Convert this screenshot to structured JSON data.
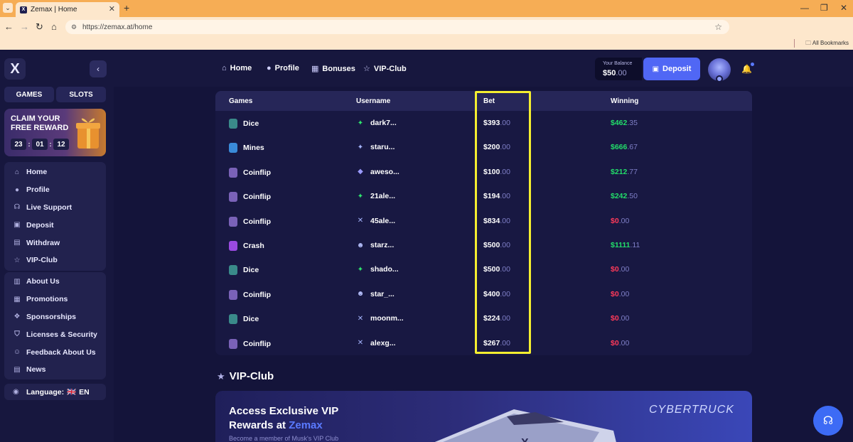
{
  "browser": {
    "tab_title": "Zemax | Home",
    "url": "https://zemax.at/home",
    "bookmarks_label": "All Bookmarks"
  },
  "sidebar": {
    "logo": "X",
    "categories": [
      "GAMES",
      "SLOTS"
    ],
    "promo": {
      "title": "CLAIM YOUR FREE REWARD",
      "timer": [
        "23",
        "01",
        "12"
      ]
    },
    "nav_primary": [
      {
        "label": "Home",
        "icon": "home-icon"
      },
      {
        "label": "Profile",
        "icon": "user-icon"
      },
      {
        "label": "Live Support",
        "icon": "headset-icon"
      },
      {
        "label": "Deposit",
        "icon": "wallet-icon"
      },
      {
        "label": "Withdraw",
        "icon": "withdraw-icon"
      },
      {
        "label": "VIP-Club",
        "icon": "star-icon"
      }
    ],
    "nav_secondary": [
      {
        "label": "About Us",
        "icon": "book-icon"
      },
      {
        "label": "Promotions",
        "icon": "gift-icon"
      },
      {
        "label": "Sponsorships",
        "icon": "handshake-icon"
      },
      {
        "label": "Licenses & Security",
        "icon": "shield-icon"
      },
      {
        "label": "Feedback About Us",
        "icon": "feedback-icon"
      },
      {
        "label": "News",
        "icon": "news-icon"
      }
    ],
    "language": {
      "label": "Language:",
      "flag": "🇬🇧",
      "code": "EN"
    }
  },
  "topnav": [
    {
      "label": "Home",
      "icon": "home-icon"
    },
    {
      "label": "Profile",
      "icon": "user-icon"
    },
    {
      "label": "Bonuses",
      "icon": "gift-icon"
    },
    {
      "label": "VIP-Club",
      "icon": "star-icon"
    }
  ],
  "wallet": {
    "balance_label": "Your Balance",
    "balance_int": "$50",
    "balance_dec": ".00",
    "deposit_label": "Deposit"
  },
  "table": {
    "headers": [
      "Games",
      "Username",
      "Bet",
      "Winning"
    ],
    "rows": [
      {
        "game": "Dice",
        "user": "dark7...",
        "bet_int": "$393",
        "bet_dec": ".00",
        "win_int": "$462",
        "win_dec": ".35",
        "win_positive": true,
        "gcolor": "#3a8a8a",
        "ucolor": "#2ee66e",
        "uglyph": "✦"
      },
      {
        "game": "Mines",
        "user": "staru...",
        "bet_int": "$200",
        "bet_dec": ".00",
        "win_int": "$666",
        "win_dec": ".67",
        "win_positive": true,
        "gcolor": "#3a8ad8",
        "ucolor": "#a6b6ff",
        "uglyph": "✦"
      },
      {
        "game": "Coinflip",
        "user": "aweso...",
        "bet_int": "$100",
        "bet_dec": ".00",
        "win_int": "$212",
        "win_dec": ".77",
        "win_positive": true,
        "gcolor": "#7a62b8",
        "ucolor": "#9a9aff",
        "uglyph": "◆"
      },
      {
        "game": "Coinflip",
        "user": "21ale...",
        "bet_int": "$194",
        "bet_dec": ".00",
        "win_int": "$242",
        "win_dec": ".50",
        "win_positive": true,
        "gcolor": "#7a62b8",
        "ucolor": "#2ee66e",
        "uglyph": "✦"
      },
      {
        "game": "Coinflip",
        "user": "45ale...",
        "bet_int": "$834",
        "bet_dec": ".00",
        "win_int": "$0",
        "win_dec": ".00",
        "win_positive": false,
        "gcolor": "#7a62b8",
        "ucolor": "#a6b6ff",
        "uglyph": "✕"
      },
      {
        "game": "Crash",
        "user": "starz...",
        "bet_int": "$500",
        "bet_dec": ".00",
        "win_int": "$1111",
        "win_dec": ".11",
        "win_positive": true,
        "gcolor": "#9a4ae0",
        "ucolor": "#b8c2ff",
        "uglyph": "☻"
      },
      {
        "game": "Dice",
        "user": "shado...",
        "bet_int": "$500",
        "bet_dec": ".00",
        "win_int": "$0",
        "win_dec": ".00",
        "win_positive": false,
        "gcolor": "#3a8a8a",
        "ucolor": "#2ee66e",
        "uglyph": "✦"
      },
      {
        "game": "Coinflip",
        "user": "star_...",
        "bet_int": "$400",
        "bet_dec": ".00",
        "win_int": "$0",
        "win_dec": ".00",
        "win_positive": false,
        "gcolor": "#7a62b8",
        "ucolor": "#b8c2ff",
        "uglyph": "☻"
      },
      {
        "game": "Dice",
        "user": "moonm...",
        "bet_int": "$224",
        "bet_dec": ".00",
        "win_int": "$0",
        "win_dec": ".00",
        "win_positive": false,
        "gcolor": "#3a8a8a",
        "ucolor": "#a6b6ff",
        "uglyph": "✕"
      },
      {
        "game": "Coinflip",
        "user": "alexg...",
        "bet_int": "$267",
        "bet_dec": ".00",
        "win_int": "$0",
        "win_dec": ".00",
        "win_positive": false,
        "gcolor": "#7a62b8",
        "ucolor": "#a6b6ff",
        "uglyph": "✕"
      }
    ]
  },
  "vip": {
    "section_title": "VIP-Club",
    "banner_line1": "Access Exclusive VIP",
    "banner_line2_pre": "Rewards at ",
    "banner_brand": "Zemax",
    "banner_sub": "Become a member of Musk's VIP Club",
    "signature": "CYBERTRUCK"
  },
  "colors": {
    "accent": "#5067f5",
    "win": "#22dd6a",
    "loss": "#ff3a5a",
    "highlight": "#f4ee30"
  }
}
